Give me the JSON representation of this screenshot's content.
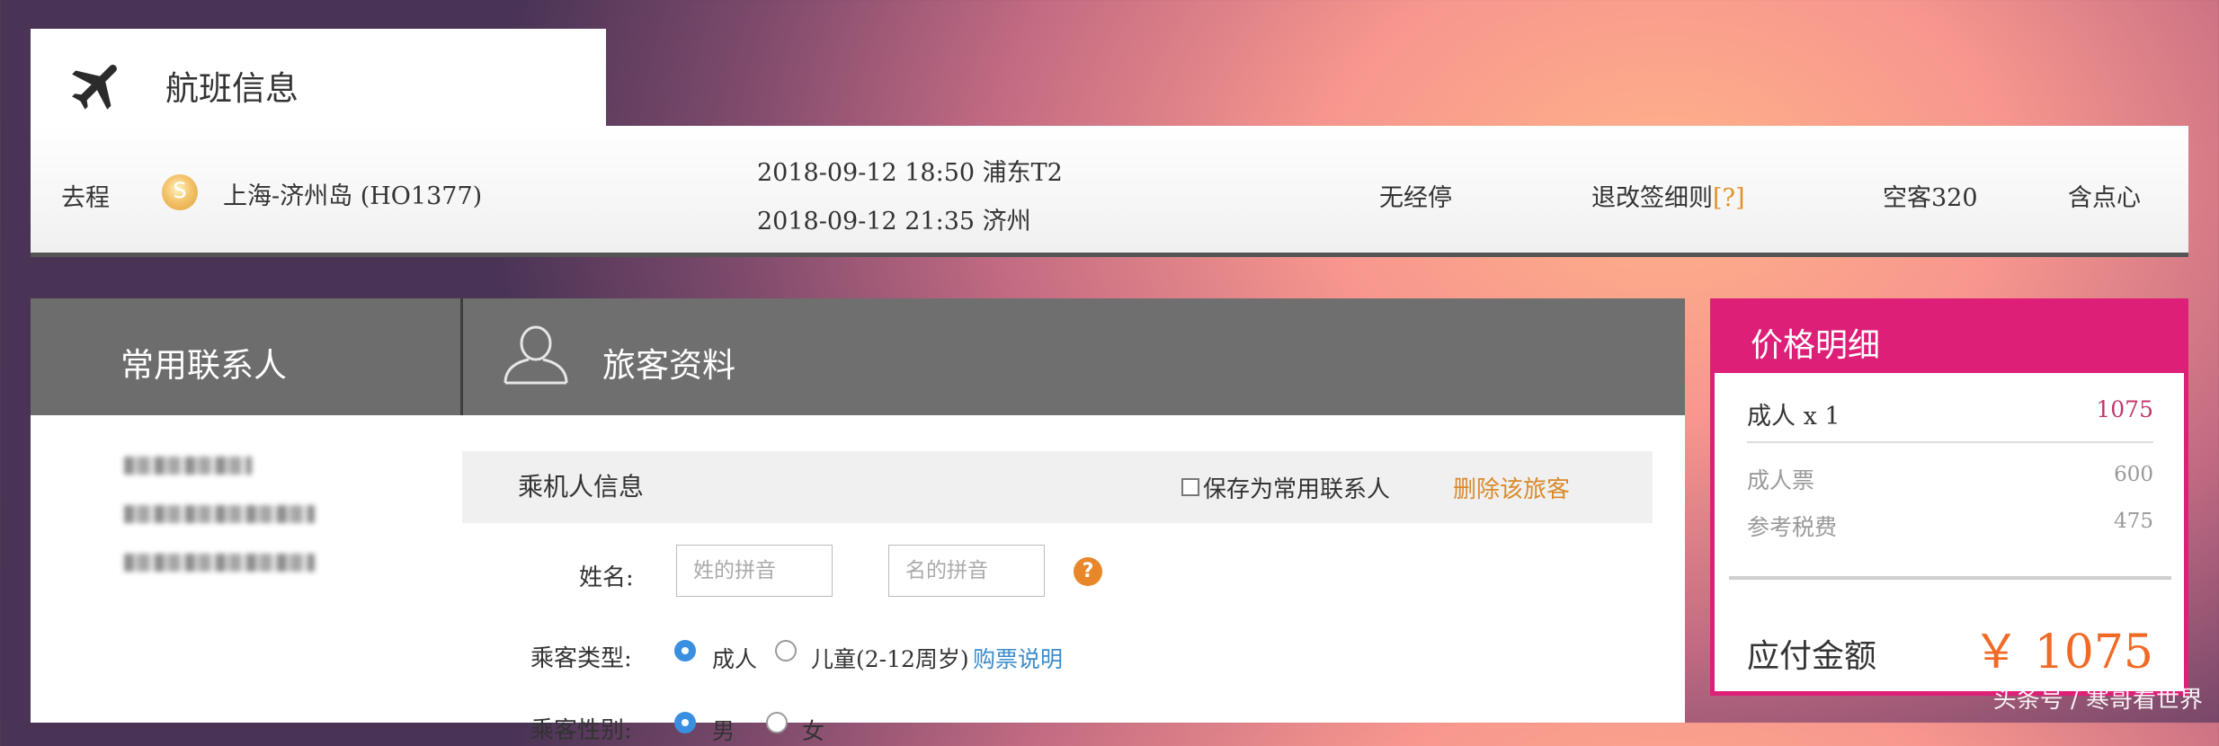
{
  "flight_tab": {
    "title": "航班信息",
    "icon": "airplane-icon"
  },
  "flight": {
    "direction": "去程",
    "route": "上海-济州岛 (HO1377)",
    "depart": "2018-09-12 18:50 浦东T2",
    "arrive": "2018-09-12 21:35 济州",
    "stops": "无经停",
    "rules": "退改签细则",
    "rules_mark": "[?]",
    "aircraft": "空客320",
    "meal": "含点心"
  },
  "tabs": {
    "contacts": "常用联系人",
    "passenger": "旅客资料"
  },
  "passenger": {
    "section_title": "乘机人信息",
    "save_label": "保存为常用联系人",
    "delete_label": "删除该旅客",
    "name_label": "姓名:",
    "last_name_placeholder": "姓的拼音",
    "first_name_placeholder": "名的拼音",
    "help_glyph": "?",
    "type_label": "乘客类型:",
    "type_adult": "成人",
    "type_child": "儿童(2-12周岁)",
    "ticket_info": "购票说明",
    "gender_label": "乘客性别:",
    "gender_male": "男",
    "gender_female": "女"
  },
  "price": {
    "title": "价格明细",
    "adult_label": "成人 x 1",
    "adult_total": "1075",
    "ticket_label": "成人票",
    "ticket_value": "600",
    "tax_label": "参考税费",
    "tax_value": "475",
    "total_label": "应付金额",
    "total_value": "￥ 1075",
    "accent_color": "#de1f78",
    "total_color": "#f06a26"
  },
  "watermark": "头条号 / 寒哥看世界"
}
